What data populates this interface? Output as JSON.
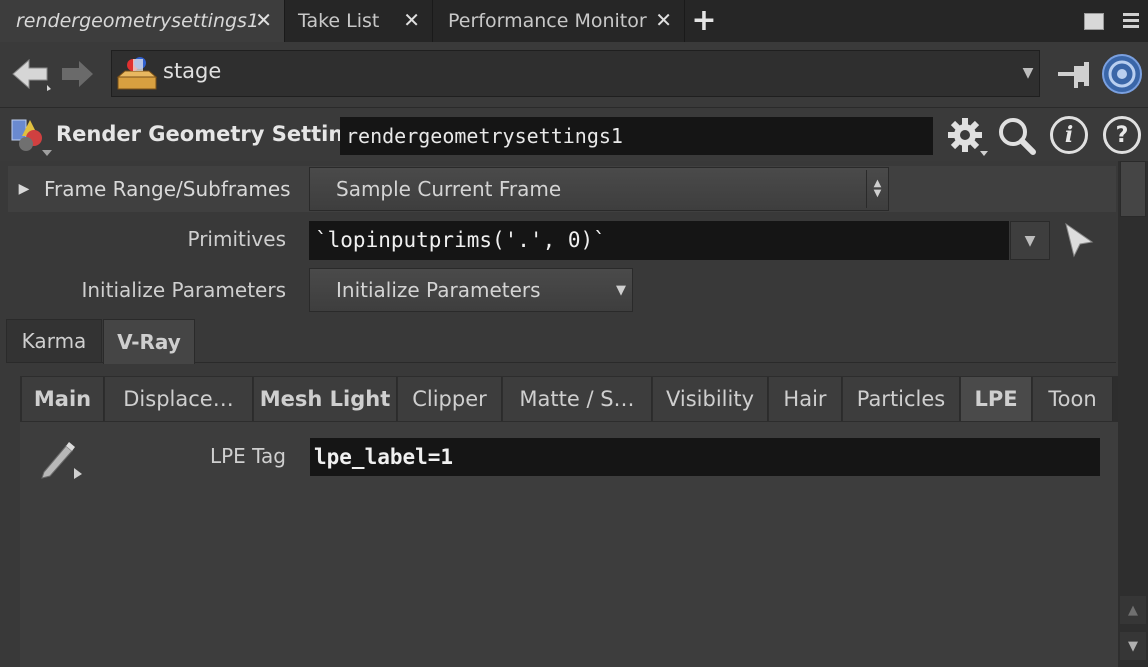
{
  "tabs": [
    {
      "label": "rendergeometrysettings1",
      "close": "✕",
      "active": true
    },
    {
      "label": "Take List",
      "close": "✕",
      "active": false
    },
    {
      "label": "Performance Monitor",
      "close": "✕",
      "active": false
    }
  ],
  "add_tab": "+",
  "path": {
    "label": "stage",
    "icon": "stage-icon"
  },
  "node": {
    "type_label": "Render Geometry Settings",
    "name": "rendergeometrysettings1"
  },
  "params": {
    "frame_range_label": "Frame Range/Subframes",
    "frame_range_value": "Sample Current Frame",
    "primitives_label": "Primitives",
    "primitives_value": "`lopinputprims('.', 0)`",
    "init_label": "Initialize Parameters",
    "init_value": "Initialize Parameters"
  },
  "renderer_tabs": [
    {
      "label": "Karma",
      "active": false
    },
    {
      "label": "V-Ray",
      "active": true
    }
  ],
  "vray_tabs": [
    {
      "label": "Main",
      "bold": true
    },
    {
      "label": "Displace…",
      "bold": false
    },
    {
      "label": "Mesh Light",
      "bold": true
    },
    {
      "label": "Clipper",
      "bold": false
    },
    {
      "label": "Matte / S…",
      "bold": false
    },
    {
      "label": "Visibility",
      "bold": false
    },
    {
      "label": "Hair",
      "bold": false
    },
    {
      "label": "Particles",
      "bold": false
    },
    {
      "label": "LPE",
      "bold": true,
      "active": true
    },
    {
      "label": "Toon",
      "bold": false
    }
  ],
  "lpe": {
    "label": "LPE Tag",
    "value": "lpe_label=1"
  },
  "colors": {
    "accent": "#3f74c0",
    "field_bg": "#151515",
    "panel_bg": "#3a3a3a"
  }
}
